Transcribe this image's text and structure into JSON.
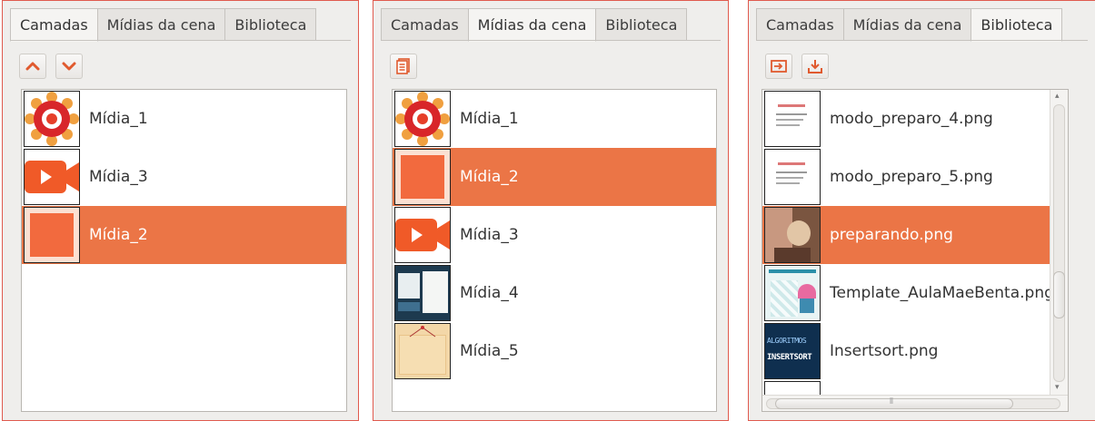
{
  "tabs": [
    "Camadas",
    "Mídias da cena",
    "Biblioteca"
  ],
  "accent_color": "#eb7546",
  "icon_color": "#e05a2e",
  "panel_camadas": {
    "active_tab": "Camadas",
    "toolbar": {
      "icons": [
        "chevron-up-icon",
        "chevron-down-icon"
      ]
    },
    "items": [
      {
        "label": "Mídia_1",
        "thumb": "mandala"
      },
      {
        "label": "Mídia_3",
        "thumb": "video"
      },
      {
        "label": "Mídia_2",
        "thumb": "orange-square",
        "selected": true
      }
    ]
  },
  "panel_midias": {
    "active_tab": "Mídias da cena",
    "toolbar": {
      "icons": [
        "document-icon"
      ]
    },
    "items": [
      {
        "label": "Mídia_1",
        "thumb": "mandala"
      },
      {
        "label": "Mídia_2",
        "thumb": "orange-square",
        "selected": true
      },
      {
        "label": "Mídia_3",
        "thumb": "video"
      },
      {
        "label": "Mídia_4",
        "thumb": "screenshot"
      },
      {
        "label": "Mídia_5",
        "thumb": "paper"
      }
    ]
  },
  "panel_biblioteca": {
    "active_tab": "Biblioteca",
    "toolbar": {
      "icons": [
        "import-icon",
        "download-icon"
      ]
    },
    "items": [
      {
        "label": "modo_preparo_4.png",
        "thumb": "doc"
      },
      {
        "label": "modo_preparo_5.png",
        "thumb": "doc"
      },
      {
        "label": "preparando.png",
        "thumb": "photo",
        "selected": true
      },
      {
        "label": "Template_AulaMaeBenta.png",
        "thumb": "template"
      },
      {
        "label": "Insertsort.png",
        "thumb": "insertsort",
        "thumb_text": [
          "ALGORITMOS",
          "INSERTSORT"
        ]
      }
    ],
    "scrollbar_glyph": "⦀"
  }
}
